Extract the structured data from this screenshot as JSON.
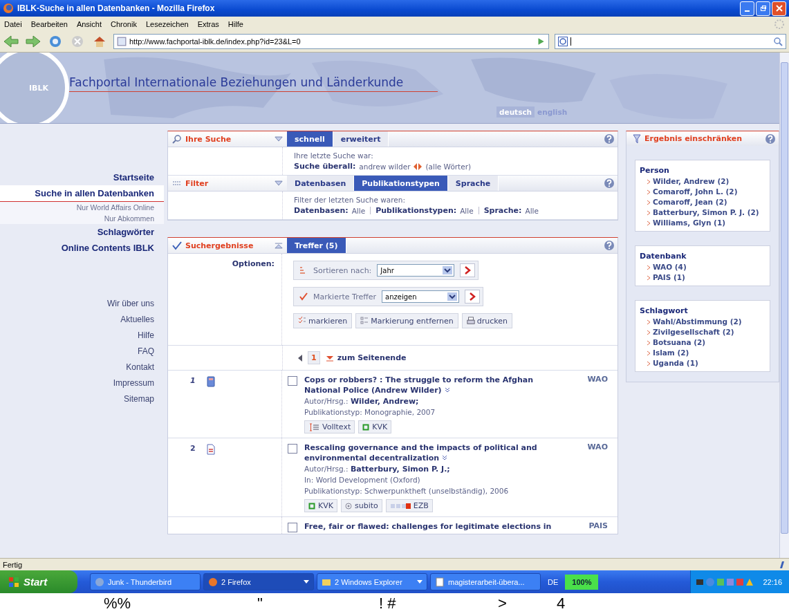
{
  "window": {
    "title": "IBLK-Suche in allen Datenbanken - Mozilla Firefox"
  },
  "menu": [
    "Datei",
    "Bearbeiten",
    "Ansicht",
    "Chronik",
    "Lesezeichen",
    "Extras",
    "Hilfe"
  ],
  "toolbar": {
    "url": "http://www.fachportal-iblk.de/index.php?id=23&L=0"
  },
  "banner": {
    "logo": "IBLK",
    "title": "Fachportal Internationale Beziehungen und Länderkunde",
    "languages": [
      {
        "label": "deutsch",
        "selected": true
      },
      {
        "label": "english",
        "selected": false
      }
    ]
  },
  "sidebar": {
    "items": [
      {
        "label": "Startseite",
        "kind": "main",
        "selected": false
      },
      {
        "label": "Suche in allen Datenbanken",
        "kind": "main",
        "selected": true
      },
      {
        "label": "Nur World Affairs Online",
        "kind": "sub",
        "selected": false
      },
      {
        "label": "Nur Abkommen",
        "kind": "sub",
        "selected": false
      },
      {
        "label": "Schlagwörter",
        "kind": "main",
        "selected": false
      },
      {
        "label": "Online Contents IBLK",
        "kind": "main",
        "selected": false
      },
      {
        "label": "Wir über uns",
        "kind": "footer",
        "selected": false
      },
      {
        "label": "Aktuelles",
        "kind": "footer",
        "selected": false
      },
      {
        "label": "Hilfe",
        "kind": "footer",
        "selected": false
      },
      {
        "label": "FAQ",
        "kind": "footer",
        "selected": false
      },
      {
        "label": "Kontakt",
        "kind": "footer",
        "selected": false
      },
      {
        "label": "Impressum",
        "kind": "footer",
        "selected": false
      },
      {
        "label": "Sitemap",
        "kind": "footer",
        "selected": false
      }
    ]
  },
  "search_panel": {
    "title": "Ihre Suche",
    "tabs": [
      {
        "label": "schnell",
        "selected": true
      },
      {
        "label": "erweitert",
        "selected": false
      }
    ],
    "intro": "Ihre letzte Suche war:",
    "query_label": "Suche überall:",
    "query": "andrew wilder",
    "mode": "(alle Wörter)"
  },
  "filter_panel": {
    "title": "Filter",
    "tabs": [
      {
        "label": "Datenbasen",
        "selected": false
      },
      {
        "label": "Publikationstypen",
        "selected": true
      },
      {
        "label": "Sprache",
        "selected": false
      }
    ],
    "intro": "Filter der letzten Suche waren:",
    "filters": [
      {
        "label": "Datenbasen:",
        "value": "Alle"
      },
      {
        "label": "Publikationstypen:",
        "value": "Alle"
      },
      {
        "label": "Sprache:",
        "value": "Alle"
      }
    ]
  },
  "results_panel": {
    "title": "Suchergebnisse",
    "tabs": [
      {
        "label": "Treffer (5)",
        "selected": true
      }
    ],
    "options_label": "Optionen:",
    "sort": {
      "label": "Sortieren nach:",
      "value": "Jahr"
    },
    "marked": {
      "label": "Markierte Treffer",
      "value": "anzeigen"
    },
    "actions": [
      {
        "label": "markieren",
        "kind": "mark"
      },
      {
        "label": "Markierung entfernen",
        "kind": "unmark"
      },
      {
        "label": "drucken",
        "kind": "print"
      }
    ],
    "pager": {
      "page": "1",
      "link": "zum Seitenende"
    },
    "records": [
      {
        "number": "1",
        "kind": "book",
        "checked": false,
        "title": "Cops or robbers? : The struggle to reform the Afghan National Police (Andrew Wilder)",
        "author_label": "Autor/Hrsg.:",
        "author": "Wilder, Andrew;",
        "lines": [
          "Publikationstyp: Monographie, 2007"
        ],
        "links": [
          {
            "label": "Volltext",
            "kind": "fulltext"
          },
          {
            "label": "KVK",
            "kind": "kvk"
          }
        ],
        "source": "WAO"
      },
      {
        "number": "2",
        "kind": "article",
        "checked": false,
        "title": "Rescaling governance and the impacts of political and environmental decentralization",
        "author_label": "Autor/Hrsg.:",
        "author": "Batterbury, Simon P. J.;",
        "lines": [
          "In: World Development (Oxford)",
          "Publikationstyp: Schwerpunktheft (unselbständig), 2006"
        ],
        "links": [
          {
            "label": "KVK",
            "kind": "kvk"
          },
          {
            "label": "subito",
            "kind": "subito"
          },
          {
            "label": "EZB",
            "kind": "ezb"
          }
        ],
        "source": "WAO"
      },
      {
        "kind": "partial",
        "checked": false,
        "title": "Free, fair or flawed: challenges for legitimate elections in",
        "source": "PAIS"
      }
    ]
  },
  "refine_panel": {
    "title": "Ergebnis einschränken",
    "groups": [
      {
        "heading": "Person",
        "items": [
          "Wilder, Andrew (2)",
          "Comaroff, John L. (2)",
          "Comaroff, Jean (2)",
          "Batterbury, Simon P. J. (2)",
          "Williams, Glyn (1)"
        ]
      },
      {
        "heading": "Datenbank",
        "items": [
          "WAO (4)",
          "PAIS (1)"
        ]
      },
      {
        "heading": "Schlagwort",
        "items": [
          "Wahl/Abstimmung (2)",
          "Zivilgesellschaft (2)",
          "Botsuana (2)",
          "Islam (2)",
          "Uganda (1)"
        ]
      }
    ]
  },
  "status_bar": {
    "text": "Fertig"
  },
  "taskbar": {
    "start": "Start",
    "tasks": [
      {
        "label": "Junk - Thunderbird",
        "kind": "mail",
        "selected": false
      },
      {
        "label": "2 Firefox",
        "kind": "firefox",
        "selected": true
      },
      {
        "label": "2 Windows Explorer",
        "kind": "folder",
        "selected": false
      },
      {
        "label": "magisterarbeit-übera...",
        "kind": "doc",
        "selected": false
      }
    ],
    "language": "DE",
    "zoom": "100%",
    "clock": "22:16"
  },
  "stray_glyphs": [
    "%%",
    "\"",
    "! #",
    ">",
    "4"
  ]
}
